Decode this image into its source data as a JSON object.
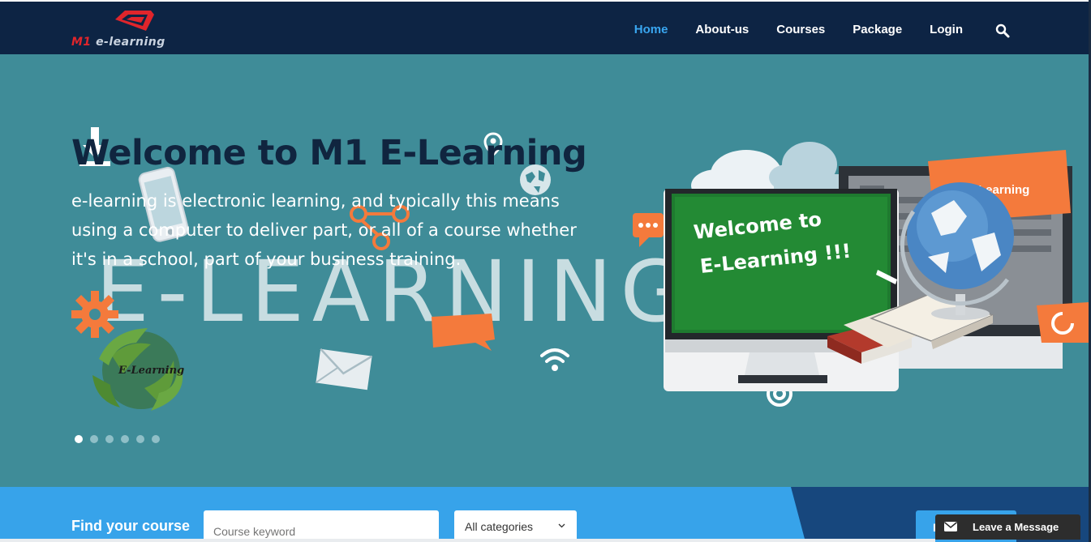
{
  "brand": {
    "logo_m1": "M1",
    "logo_text": "e-learning"
  },
  "nav": {
    "items": [
      {
        "label": "Home",
        "active": true
      },
      {
        "label": "About-us",
        "active": false
      },
      {
        "label": "Courses",
        "active": false
      },
      {
        "label": "Package",
        "active": false
      },
      {
        "label": "Login",
        "active": false
      }
    ],
    "search_icon": "search-icon"
  },
  "hero": {
    "title": "Welcome to M1 E-Learning",
    "description": "e-learning is electronic learning, and typically this means using a computer to deliver part, or all of a course whether it's in a school, part of your business training.",
    "watermark": "E-LEARNING",
    "badge_text": "M1 E-Learning",
    "board_line1": "Welcome to",
    "board_line2": "E-Learning !!!",
    "globe_label": "E-Learning",
    "slides": 6,
    "active_slide": 1
  },
  "search": {
    "label": "Find your course",
    "keyword_placeholder": "Course keyword",
    "category_value": "All categories",
    "button_label": "Find"
  },
  "chat": {
    "label": "Leave a Message",
    "icon": "mail-icon"
  },
  "colors": {
    "header_bg": "#0d2444",
    "hero_bg": "#3f8c98",
    "accent": "#39a6f0",
    "strip_bg": "#37a3ea",
    "strip_dark": "#17477d",
    "orange": "#f47a3c",
    "chat_bg": "#2d2d2d"
  }
}
